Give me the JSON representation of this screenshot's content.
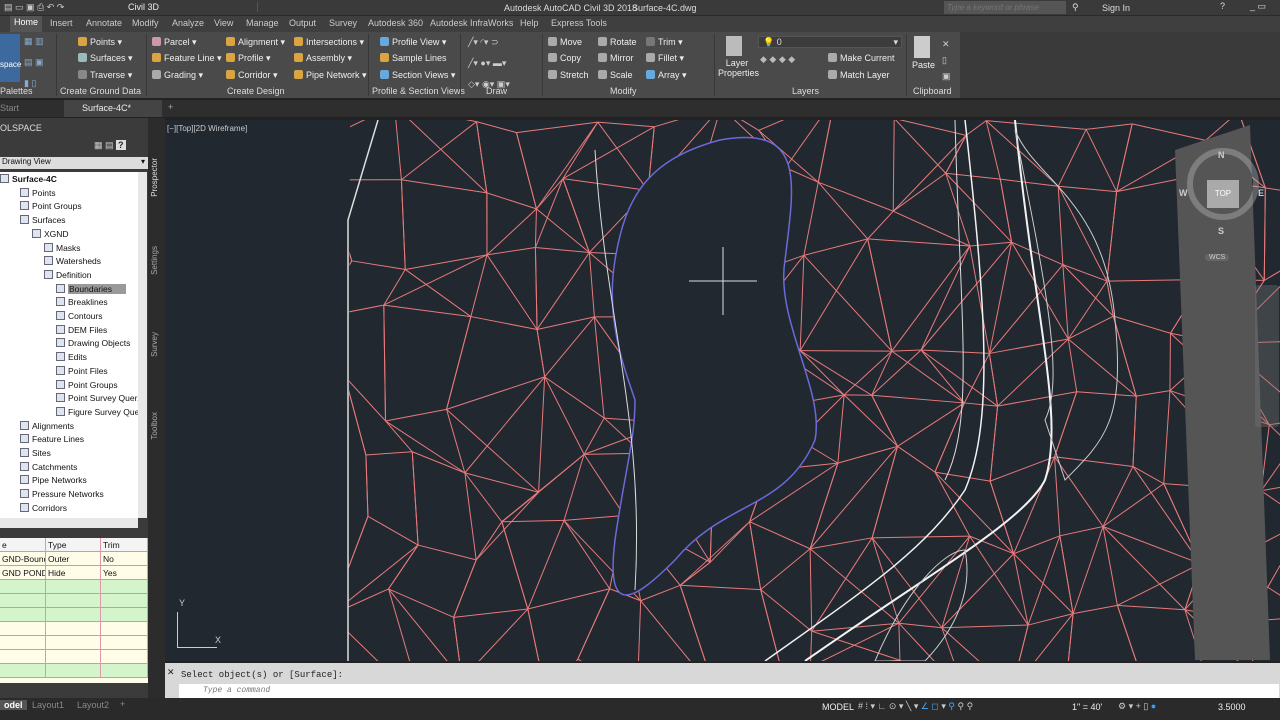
{
  "title": {
    "workspace": "Civil 3D",
    "app": "Autodesk AutoCAD Civil 3D 2018",
    "file": "Surface-4C.dwg",
    "search_placeholder": "Type a keyword or phrase",
    "sign_in": "Sign In"
  },
  "ribbon_tabs": [
    "Home",
    "Insert",
    "Annotate",
    "Modify",
    "Analyze",
    "View",
    "Manage",
    "Output",
    "Survey",
    "Autodesk 360",
    "Autodesk InfraWorks",
    "Help",
    "Express Tools"
  ],
  "ribbon": {
    "palettes": {
      "label": "Palettes",
      "btn": "space"
    },
    "ground": {
      "label": "Create Ground Data",
      "items": [
        "Points",
        "Surfaces",
        "Traverse"
      ]
    },
    "design": {
      "label": "Create Design",
      "items": [
        "Parcel",
        "Feature Line",
        "Grading",
        "Alignment",
        "Profile",
        "Corridor",
        "Intersections",
        "Assembly",
        "Pipe Network"
      ]
    },
    "profile": {
      "label": "Profile & Section Views",
      "items": [
        "Profile View",
        "Sample Lines",
        "Section Views"
      ]
    },
    "draw": {
      "label": "Draw"
    },
    "modify": {
      "label": "Modify",
      "items": [
        "Move",
        "Copy",
        "Stretch",
        "Rotate",
        "Mirror",
        "Scale",
        "Trim",
        "Fillet",
        "Array"
      ]
    },
    "layers": {
      "label": "Layers",
      "layer_props": "Layer Properties",
      "current_layer": "0",
      "items": [
        "Make Current",
        "Match Layer"
      ]
    },
    "clipboard": {
      "label": "Clipboard",
      "paste": "Paste"
    }
  },
  "doc_tabs": [
    "Start",
    "Surface-4C*"
  ],
  "toolspace": {
    "title": "OLSPACE",
    "view": "Drawing View",
    "side_tabs": [
      "Prospector",
      "Settings",
      "Survey",
      "Toolbox"
    ],
    "tree": [
      "Surface-4C",
      "Points",
      "Point Groups",
      "Surfaces",
      "XGND",
      "Masks",
      "Watersheds",
      "Definition",
      "Boundaries",
      "Breaklines",
      "Contours",
      "DEM Files",
      "Drawing Objects",
      "Edits",
      "Point Files",
      "Point Groups",
      "Point Survey Quer...",
      "Figure Survey Que...",
      "Alignments",
      "Feature Lines",
      "Sites",
      "Catchments",
      "Pipe Networks",
      "Pressure Networks",
      "Corridors"
    ],
    "grid_headers": [
      "e",
      "Type",
      "Trim"
    ],
    "grid_rows": [
      [
        "GND-Bound.",
        "Outer",
        "No"
      ],
      [
        "GND POND I",
        "Hide",
        "Yes"
      ]
    ]
  },
  "viewport": {
    "label": "[−][Top][2D Wireframe]",
    "compass": [
      "N",
      "S",
      "E",
      "W"
    ],
    "cube": "TOP",
    "wcs": "WCS",
    "ucs_x": "X",
    "ucs_y": "Y"
  },
  "command": {
    "history": "Select object(s) or [Surface]:",
    "placeholder": "Type a command"
  },
  "layout_tabs": [
    "odel",
    "Layout1",
    "Layout2"
  ],
  "status": {
    "model": "MODEL",
    "scale": "1\" = 40'",
    "value": "3.5000"
  },
  "colors": {
    "tin": "#e87a7a",
    "boundary": "#6a6ad8",
    "canvas": "#212830"
  }
}
